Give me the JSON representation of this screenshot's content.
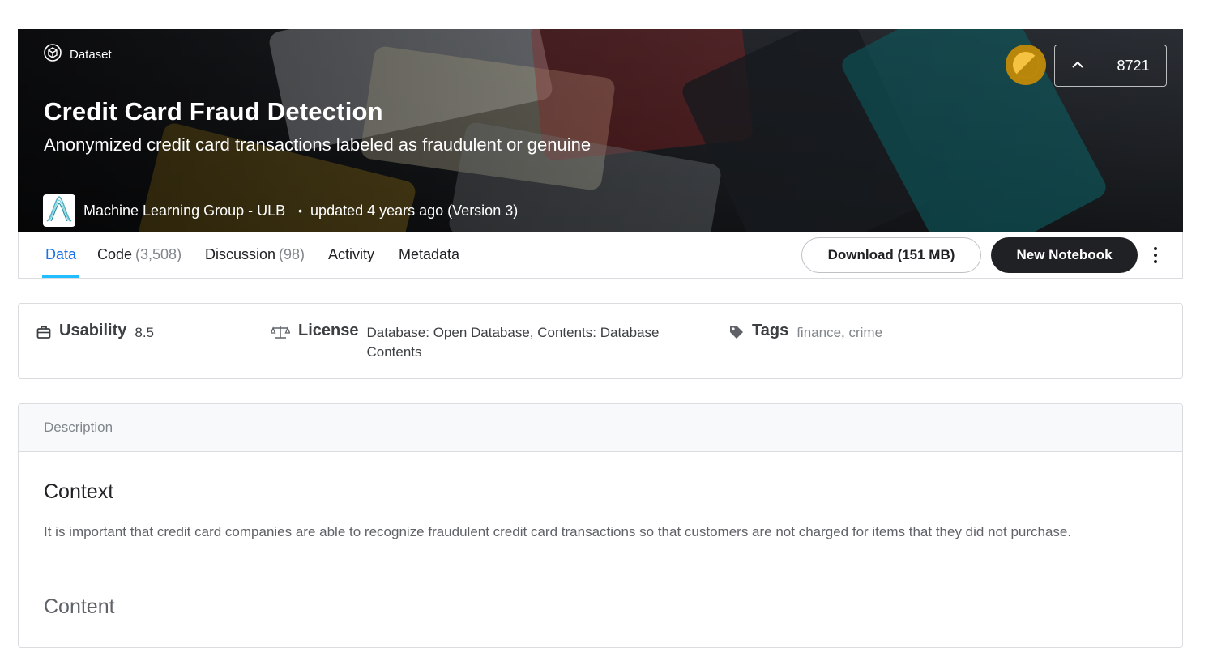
{
  "header": {
    "kind_label": "Dataset",
    "title": "Credit Card Fraud Detection",
    "subtitle": "Anonymized credit card transactions labeled as fraudulent or genuine",
    "owner": "Machine Learning Group - ULB",
    "separator": "•",
    "updated": "updated 4 years ago (Version 3)",
    "vote_count": "8721",
    "medal_color": "#b8860b",
    "icons": {
      "kind": "dataset-cube-icon",
      "medal": "gold-medal-icon",
      "upvote": "chevron-up-icon",
      "avatar": "ulb-logo-icon"
    }
  },
  "tabs": [
    {
      "label": "Data",
      "count": ""
    },
    {
      "label": "Code",
      "count": "(3,508)"
    },
    {
      "label": "Discussion",
      "count": "(98)"
    },
    {
      "label": "Activity",
      "count": ""
    },
    {
      "label": "Metadata",
      "count": ""
    }
  ],
  "active_tab": "Data",
  "actions": {
    "download_label": "Download (151 MB)",
    "new_notebook_label": "New Notebook",
    "more_icon": "more-vert-icon"
  },
  "meta": {
    "usability_label": "Usability",
    "usability_value": "8.5",
    "license_label": "License",
    "license_value": "Database: Open Database, Contents: Database Contents",
    "tags_label": "Tags",
    "tags": [
      "finance",
      "crime"
    ],
    "icons": {
      "usability": "briefcase-icon",
      "license": "scale-icon",
      "tags": "tag-icon"
    }
  },
  "description": {
    "header": "Description",
    "context_heading": "Context",
    "context_text": "It is important that credit card companies are able to recognize fraudulent credit card transactions so that customers are not charged for items that they did not purchase.",
    "content_heading": "Content"
  },
  "colors": {
    "accent": "#20beff",
    "active_tab_text": "#1a73e8",
    "primary_button": "#202124"
  }
}
